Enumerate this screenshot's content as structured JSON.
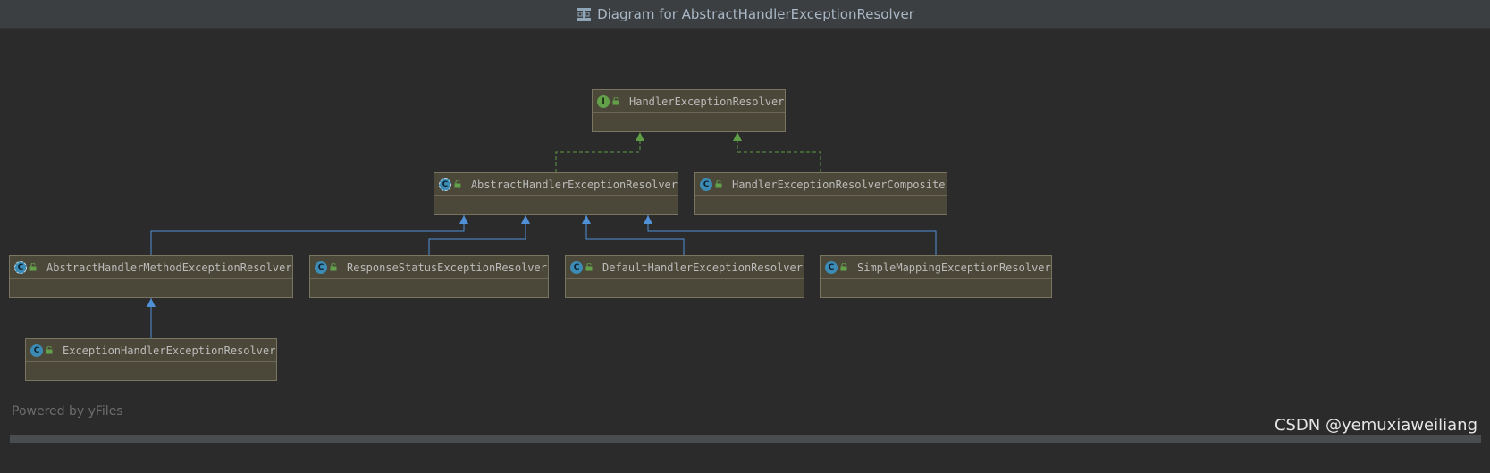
{
  "window": {
    "title": "Diagram for AbstractHandlerExceptionResolver",
    "title_icon": "uml-diagram-icon"
  },
  "colors": {
    "implements_edge": "#5e9d45",
    "extends_edge": "#4f90d6",
    "node_fill": "#4c4839",
    "node_border": "#7a7560"
  },
  "nodes": [
    {
      "id": "her",
      "name": "HandlerExceptionResolver",
      "kind": "interface",
      "kind_letter": "I",
      "visibility": "public"
    },
    {
      "id": "aher",
      "name": "AbstractHandlerExceptionResolver",
      "kind": "abstract-class",
      "kind_letter": "C",
      "visibility": "public"
    },
    {
      "id": "herc",
      "name": "HandlerExceptionResolverComposite",
      "kind": "class",
      "kind_letter": "C",
      "visibility": "public"
    },
    {
      "id": "ahmer",
      "name": "AbstractHandlerMethodExceptionResolver",
      "kind": "abstract-class",
      "kind_letter": "C",
      "visibility": "public"
    },
    {
      "id": "rser",
      "name": "ResponseStatusExceptionResolver",
      "kind": "class",
      "kind_letter": "C",
      "visibility": "public"
    },
    {
      "id": "dher",
      "name": "DefaultHandlerExceptionResolver",
      "kind": "class",
      "kind_letter": "C",
      "visibility": "public"
    },
    {
      "id": "smer",
      "name": "SimpleMappingExceptionResolver",
      "kind": "class",
      "kind_letter": "C",
      "visibility": "public"
    },
    {
      "id": "eher",
      "name": "ExceptionHandlerExceptionResolver",
      "kind": "class",
      "kind_letter": "C",
      "visibility": "public"
    }
  ],
  "edges": [
    {
      "from": "aher",
      "to": "her",
      "type": "implements"
    },
    {
      "from": "herc",
      "to": "her",
      "type": "implements"
    },
    {
      "from": "ahmer",
      "to": "aher",
      "type": "extends"
    },
    {
      "from": "rser",
      "to": "aher",
      "type": "extends"
    },
    {
      "from": "dher",
      "to": "aher",
      "type": "extends"
    },
    {
      "from": "smer",
      "to": "aher",
      "type": "extends"
    },
    {
      "from": "eher",
      "to": "ahmer",
      "type": "extends"
    }
  ],
  "footer": {
    "powered_by": "Powered by yFiles",
    "watermark": "CSDN @yemuxiaweiliang"
  }
}
